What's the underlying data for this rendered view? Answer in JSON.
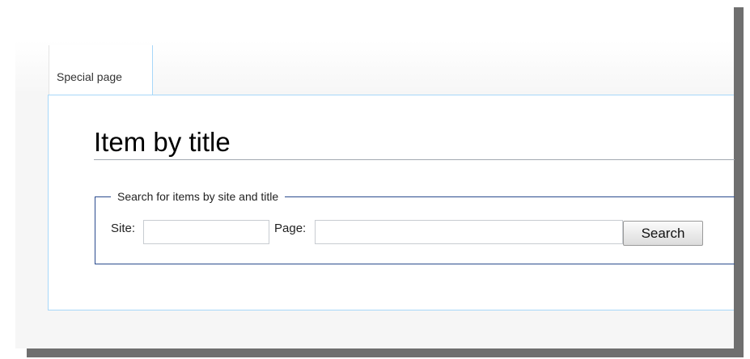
{
  "tabs": {
    "special_page": "Special page"
  },
  "page": {
    "title": "Item by title"
  },
  "search_form": {
    "legend": "Search for items by site and title",
    "site_label": "Site:",
    "site_value": "",
    "page_label": "Page:",
    "page_value": "",
    "search_button": "Search"
  },
  "colors": {
    "content_border": "#a7d7f9",
    "fieldset_border": "#2a4b8d",
    "shadow": "#6f6f6f"
  }
}
